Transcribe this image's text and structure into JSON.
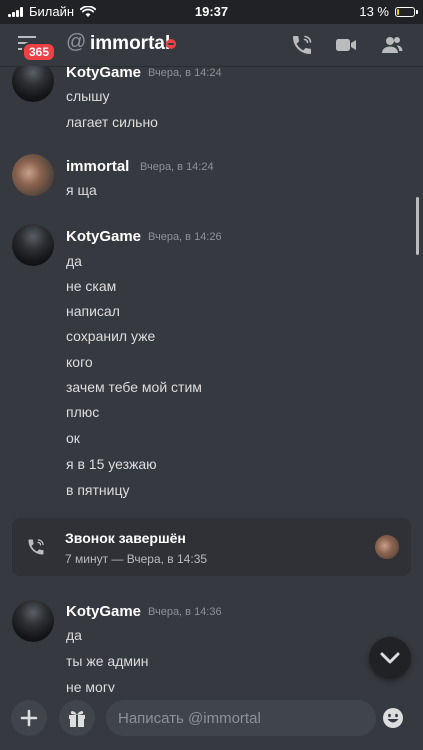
{
  "status_bar": {
    "carrier": "Билайн",
    "time": "19:37",
    "battery_text": "13 %",
    "battery_level": 0.13
  },
  "header": {
    "badge_count": "365",
    "at_symbol": "@",
    "title": "immortal",
    "status": "dnd",
    "status_color": "#ed4245",
    "icons": [
      "phone-call-icon",
      "video-camera-icon",
      "members-icon"
    ]
  },
  "messages": [
    {
      "author": "KotyGame",
      "timestamp": "Вчера, в 14:24",
      "lines": [
        "слышу",
        "лагает сильно"
      ]
    },
    {
      "author": "immortal",
      "timestamp": "Вчера, в 14:24",
      "lines": [
        "я ща"
      ]
    },
    {
      "author": "KotyGame",
      "timestamp": "Вчера, в 14:26",
      "lines": [
        "да",
        "не скам",
        "написал",
        "сохранил уже",
        "кого",
        "зачем тебе мой стим",
        "плюс",
        "ок",
        "я в 15 уезжаю",
        "в пятницу"
      ]
    },
    {
      "author": "KotyGame",
      "timestamp": "Вчера, в 14:36",
      "lines": [
        "да",
        "ты же админ",
        "не могу"
      ]
    }
  ],
  "call": {
    "title": "Звонок завершён",
    "subtitle": "7 минут — Вчера, в 14:35"
  },
  "composer": {
    "placeholder": "Написать @immortal"
  },
  "colors": {
    "background": "#36393f",
    "status_bar": "#202225",
    "badge": "#ed4245",
    "input": "#40444b",
    "emoji": "#dcddde"
  }
}
